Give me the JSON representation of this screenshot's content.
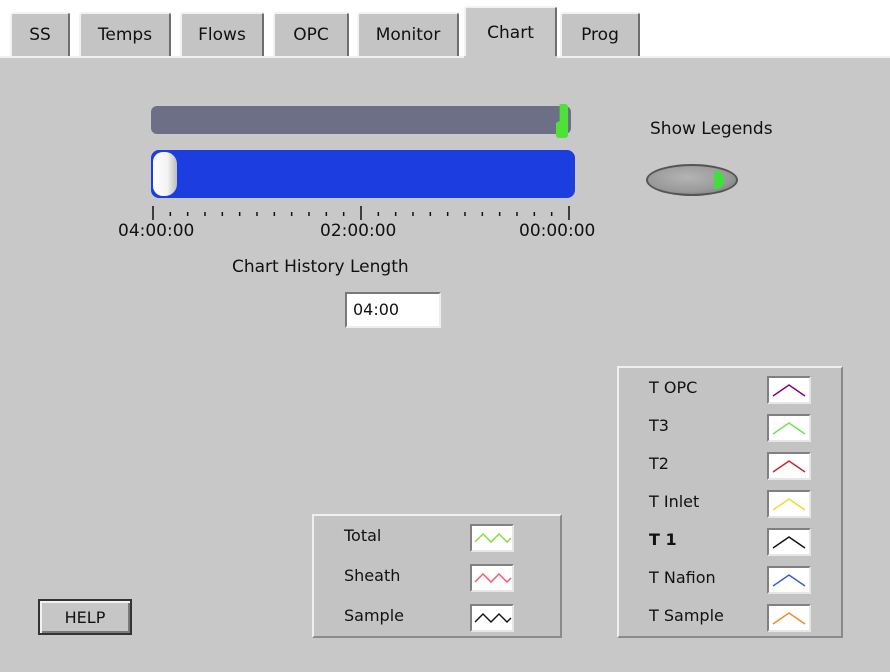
{
  "tabs": [
    {
      "label": "SS",
      "active": false
    },
    {
      "label": "Temps",
      "active": false
    },
    {
      "label": "Flows",
      "active": false
    },
    {
      "label": "OPC",
      "active": false
    },
    {
      "label": "Monitor",
      "active": false
    },
    {
      "label": "Chart",
      "active": true
    },
    {
      "label": "Prog",
      "active": false
    }
  ],
  "slider": {
    "scale_left": "04:00:00",
    "scale_mid": "02:00:00",
    "scale_right": "00:00:00",
    "caption": "Chart History Length",
    "value": "04:00",
    "position_fraction": 0.0
  },
  "show_legends": {
    "label": "Show Legends",
    "on": true
  },
  "flow_legend": [
    {
      "label": "Total",
      "color": "#7fdc3a",
      "icon": "wave-icon"
    },
    {
      "label": "Sheath",
      "color": "#ff4f6a",
      "icon": "wave-icon"
    },
    {
      "label": "Sample",
      "color": "#111111",
      "icon": "wave-icon"
    }
  ],
  "temp_legend": [
    {
      "label": "T OPC",
      "color": "#800080",
      "icon": "peak-icon"
    },
    {
      "label": "T3",
      "color": "#6ee052",
      "icon": "peak-icon"
    },
    {
      "label": "T2",
      "color": "#d0202a",
      "icon": "peak-icon"
    },
    {
      "label": "T Inlet",
      "color": "#e8e020",
      "icon": "peak-icon"
    },
    {
      "label": "T 1",
      "color": "#111111",
      "icon": "peak-icon"
    },
    {
      "label": "T Nafion",
      "color": "#2f5fd8",
      "icon": "peak-icon"
    },
    {
      "label": "T Sample",
      "color": "#f08a24",
      "icon": "peak-icon"
    }
  ],
  "help": {
    "label": "HELP"
  }
}
